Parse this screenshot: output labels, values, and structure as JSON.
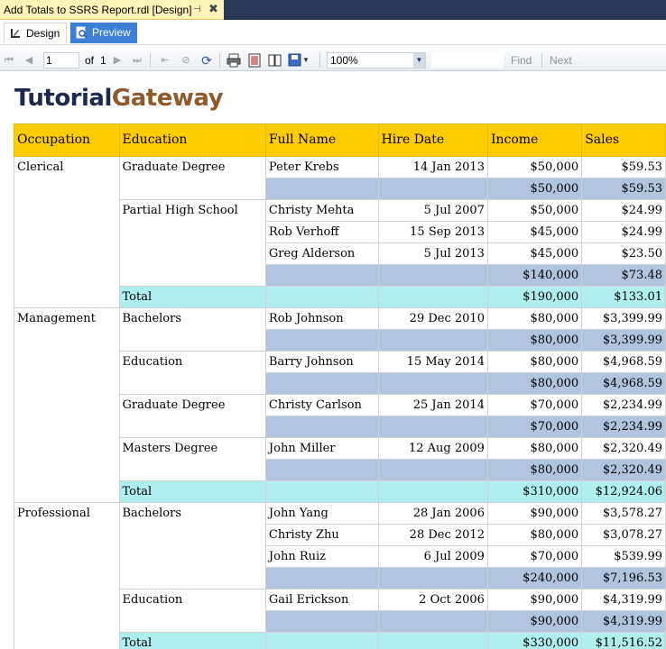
{
  "doc_tab": {
    "title": "Add Totals to SSRS Report.rdl [Design]"
  },
  "view_tabs": {
    "design": "Design",
    "preview": "Preview"
  },
  "toolbar": {
    "page_current": "1",
    "page_of": "of",
    "page_total": "1",
    "zoom": "100%",
    "find": "Find",
    "next": "Next"
  },
  "logo": {
    "part1": "Tutorial",
    "part2": "Gateway"
  },
  "colors": {
    "header": "#ffcc00",
    "subtotal": "#b0c4de",
    "total": "#afeeee"
  },
  "table": {
    "headers": [
      "Occupation",
      "Education",
      "Full Name",
      "Hire Date",
      "Income",
      "Sales"
    ],
    "groups": [
      {
        "occupation": "Clerical",
        "educations": [
          {
            "name": "Graduate Degree",
            "rows": [
              {
                "full_name": "Peter Krebs",
                "hire_date": "14 Jan 2013",
                "income": "$50,000",
                "sales": "$59.53"
              }
            ],
            "subtotal": {
              "income": "$50,000",
              "sales": "$59.53"
            }
          },
          {
            "name": "Partial High School",
            "rows": [
              {
                "full_name": "Christy Mehta",
                "hire_date": "5 Jul 2007",
                "income": "$50,000",
                "sales": "$24.99"
              },
              {
                "full_name": "Rob Verhoff",
                "hire_date": "15 Sep 2013",
                "income": "$45,000",
                "sales": "$24.99"
              },
              {
                "full_name": "Greg Alderson",
                "hire_date": "5 Jul 2013",
                "income": "$45,000",
                "sales": "$23.50"
              }
            ],
            "subtotal": {
              "income": "$140,000",
              "sales": "$73.48"
            }
          }
        ],
        "total": {
          "label": "Total",
          "income": "$190,000",
          "sales": "$133.01"
        }
      },
      {
        "occupation": "Management",
        "educations": [
          {
            "name": "Bachelors",
            "rows": [
              {
                "full_name": "Rob Johnson",
                "hire_date": "29 Dec 2010",
                "income": "$80,000",
                "sales": "$3,399.99"
              }
            ],
            "subtotal": {
              "income": "$80,000",
              "sales": "$3,399.99"
            }
          },
          {
            "name": "Education",
            "rows": [
              {
                "full_name": "Barry Johnson",
                "hire_date": "15 May 2014",
                "income": "$80,000",
                "sales": "$4,968.59"
              }
            ],
            "subtotal": {
              "income": "$80,000",
              "sales": "$4,968.59"
            }
          },
          {
            "name": "Graduate Degree",
            "rows": [
              {
                "full_name": "Christy Carlson",
                "hire_date": "25 Jan 2014",
                "income": "$70,000",
                "sales": "$2,234.99"
              }
            ],
            "subtotal": {
              "income": "$70,000",
              "sales": "$2,234.99"
            }
          },
          {
            "name": "Masters Degree",
            "rows": [
              {
                "full_name": "John Miller",
                "hire_date": "12 Aug 2009",
                "income": "$80,000",
                "sales": "$2,320.49"
              }
            ],
            "subtotal": {
              "income": "$80,000",
              "sales": "$2,320.49"
            }
          }
        ],
        "total": {
          "label": "Total",
          "income": "$310,000",
          "sales": "$12,924.06"
        }
      },
      {
        "occupation": "Professional",
        "educations": [
          {
            "name": "Bachelors",
            "rows": [
              {
                "full_name": "John Yang",
                "hire_date": "28 Jan 2006",
                "income": "$90,000",
                "sales": "$3,578.27"
              },
              {
                "full_name": "Christy Zhu",
                "hire_date": "28 Dec 2012",
                "income": "$80,000",
                "sales": "$3,078.27"
              },
              {
                "full_name": "John Ruiz",
                "hire_date": "6 Jul 2009",
                "income": "$70,000",
                "sales": "$539.99"
              }
            ],
            "subtotal": {
              "income": "$240,000",
              "sales": "$7,196.53"
            }
          },
          {
            "name": "Education",
            "rows": [
              {
                "full_name": "Gail Erickson",
                "hire_date": "2 Oct 2006",
                "income": "$90,000",
                "sales": "$4,319.99"
              }
            ],
            "subtotal": {
              "income": "$90,000",
              "sales": "$4,319.99"
            }
          }
        ],
        "total": {
          "label": "Total",
          "income": "$330,000",
          "sales": "$11,516.52"
        }
      }
    ]
  }
}
